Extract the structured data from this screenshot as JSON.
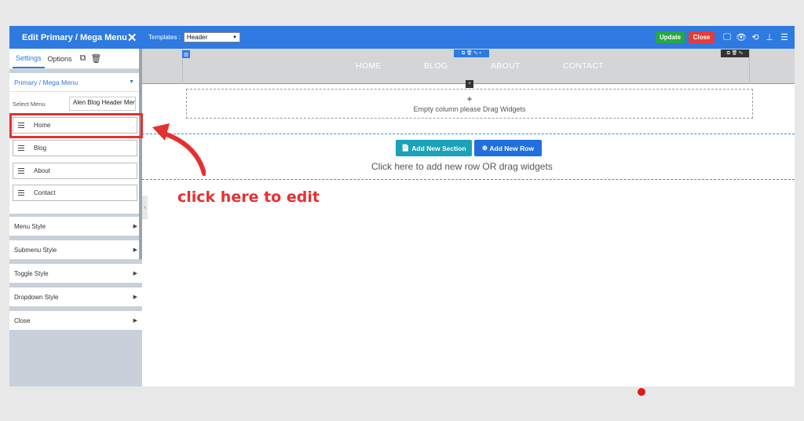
{
  "sidebar": {
    "title": "Edit Primary / Mega Menu",
    "tabs": [
      "Settings",
      "Options"
    ],
    "section_title": "Primary / Mega Menu",
    "select_label": "Select Menu",
    "select_value": "Alen Blog Header Menu",
    "menu_items": [
      "Home",
      "Blog",
      "About",
      "Contact"
    ],
    "accordion": [
      "Menu Style",
      "Submenu Style",
      "Toggle Style",
      "Dropdown Style",
      "Close"
    ]
  },
  "topbar": {
    "templates_label": "Templates :",
    "template_value": "Header",
    "update_label": "Update",
    "close_label": "Close"
  },
  "canvas": {
    "nav": [
      "HOME",
      "BLOG",
      "ABOUT",
      "CONTACT"
    ],
    "empty_column": "Empty column please Drag Widgets",
    "add_section": "Add New Section",
    "add_row": "Add New Row",
    "hint": "Click here to add new row OR drag widgets"
  },
  "annotation": "click here to edit",
  "colors": {
    "accent": "#2e7ae0",
    "annotation": "#e53030",
    "update": "#27a745",
    "close": "#e53b3b"
  }
}
